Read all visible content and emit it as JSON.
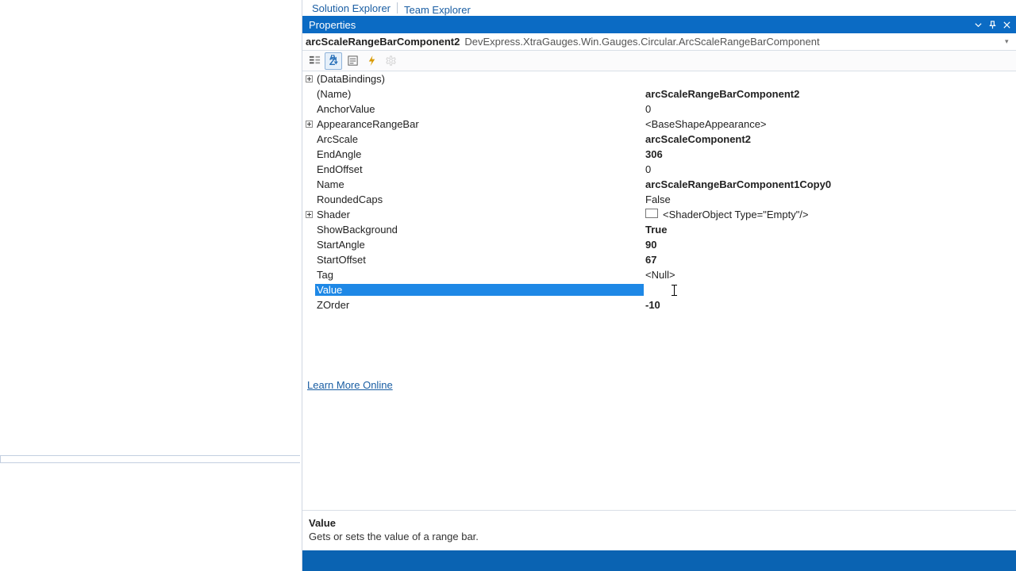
{
  "tabs": {
    "solution": "Solution Explorer",
    "team": "Team Explorer"
  },
  "panel": {
    "title": "Properties"
  },
  "object": {
    "name": "arcScaleRangeBarComponent2",
    "type": "DevExpress.XtraGauges.Win.Gauges.Circular.ArcScaleRangeBarComponent"
  },
  "rows": {
    "databindings": {
      "label": "(DataBindings)",
      "value": ""
    },
    "name_paren": {
      "label": "(Name)",
      "value": "arcScaleRangeBarComponent2"
    },
    "anchorvalue": {
      "label": "AnchorValue",
      "value": "0"
    },
    "appearancerangebar": {
      "label": "AppearanceRangeBar",
      "value": "<BaseShapeAppearance>"
    },
    "arcscale": {
      "label": "ArcScale",
      "value": "arcScaleComponent2"
    },
    "endangle": {
      "label": "EndAngle",
      "value": "306"
    },
    "endoffset": {
      "label": "EndOffset",
      "value": "0"
    },
    "name": {
      "label": "Name",
      "value": "arcScaleRangeBarComponent1Copy0"
    },
    "roundedcaps": {
      "label": "RoundedCaps",
      "value": "False"
    },
    "shader": {
      "label": "Shader",
      "value": "<ShaderObject Type=\"Empty\"/>"
    },
    "showbackground": {
      "label": "ShowBackground",
      "value": "True"
    },
    "startangle": {
      "label": "StartAngle",
      "value": "90"
    },
    "startoffset": {
      "label": "StartOffset",
      "value": "67"
    },
    "tag": {
      "label": "Tag",
      "value": "<Null>"
    },
    "value": {
      "label": "Value",
      "value": ""
    },
    "zorder": {
      "label": "ZOrder",
      "value": "-10"
    }
  },
  "link": {
    "learn": "Learn More Online"
  },
  "desc": {
    "title": "Value",
    "body": "Gets or sets the value of a range bar."
  }
}
